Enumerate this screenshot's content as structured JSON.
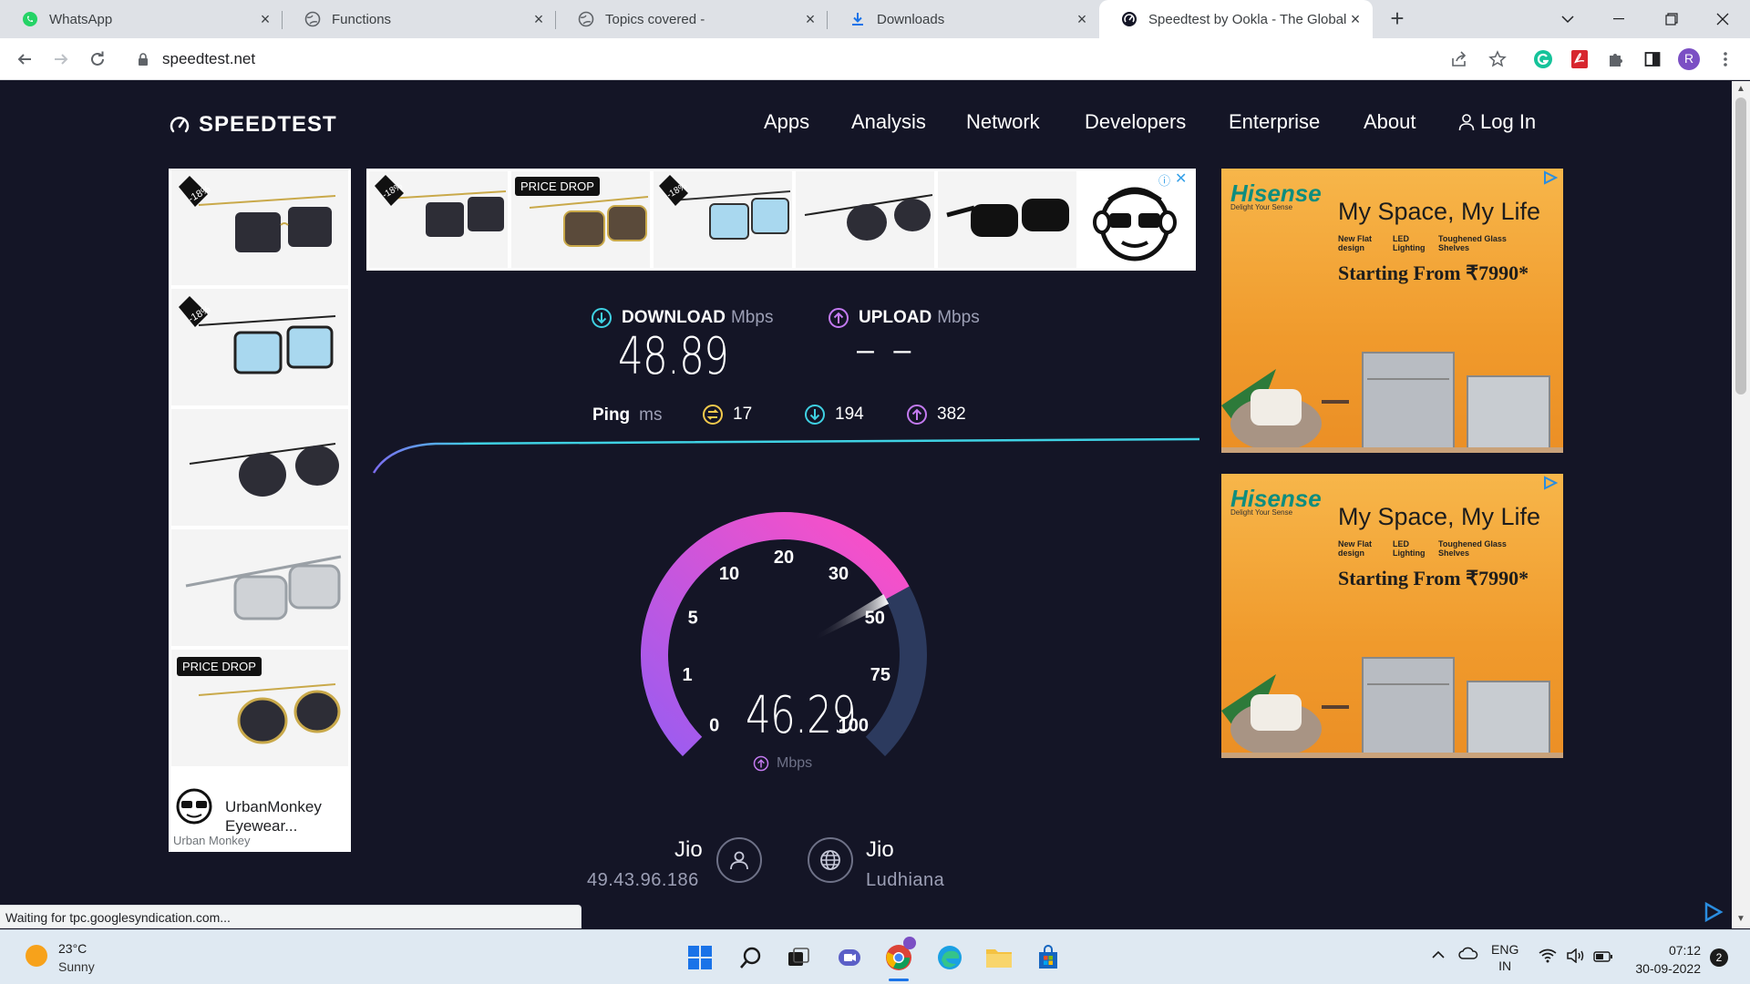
{
  "browser": {
    "tabs": [
      {
        "title": "WhatsApp",
        "icon": "whatsapp-icon",
        "active": false
      },
      {
        "title": "Functions",
        "icon": "globe-icon",
        "active": false
      },
      {
        "title": "Topics covered -",
        "icon": "globe-icon",
        "active": false
      },
      {
        "title": "Downloads",
        "icon": "download-icon",
        "active": false
      },
      {
        "title": "Speedtest by Ookla - The Global",
        "icon": "speedtest-icon",
        "active": true
      }
    ],
    "new_tab": "+",
    "url": "speedtest.net",
    "profile_initial": "R"
  },
  "site": {
    "logo": "SPEEDTEST",
    "nav": [
      "Apps",
      "Analysis",
      "Network",
      "Developers",
      "Enterprise",
      "About"
    ],
    "login": "Log In"
  },
  "ads": {
    "left_badges": {
      "pct": "-18%",
      "drop": "PRICE DROP"
    },
    "left_brand_line1": "UrbanMonkey",
    "left_brand_line2": "Eyewear...",
    "left_advertiser": "Urban Monkey",
    "top_badges": {
      "pct": "-18%",
      "drop": "PRICE DROP"
    },
    "right": {
      "brand": "Hisense",
      "brand_tag": "Delight Your Sense",
      "headline": "My Space, My Life",
      "features": [
        "New Flat design",
        "LED Lighting",
        "Toughened Glass Shelves"
      ],
      "price": "Starting From ₹7990*"
    }
  },
  "speed": {
    "download_label": "DOWNLOAD",
    "download_unit": "Mbps",
    "download_value": "48.89",
    "upload_label": "UPLOAD",
    "upload_unit": "Mbps",
    "upload_value": "– –",
    "ping_label": "Ping",
    "ping_unit": "ms",
    "ping_idle": "17",
    "ping_download": "194",
    "ping_upload": "382"
  },
  "gauge": {
    "ticks": [
      "0",
      "1",
      "5",
      "10",
      "20",
      "30",
      "50",
      "75",
      "100"
    ],
    "current_value": "46.29",
    "current_unit": "Mbps",
    "needle_value": 46.29
  },
  "server": {
    "isp": "Jio",
    "ip": "49.43.96.186",
    "host": "Jio",
    "location": "Ludhiana"
  },
  "status_text": "Waiting for tpc.googlesyndication.com...",
  "taskbar": {
    "temp": "23°C",
    "weather": "Sunny",
    "lang1": "ENG",
    "lang2": "IN",
    "time": "07:12",
    "date": "30-09-2022",
    "notif_count": "2"
  },
  "colors": {
    "page_bg": "#141526",
    "download_accent": "#3fd1e3",
    "upload_accent": "#c37af0",
    "gauge_gradient_start": "#9b5cf0",
    "gauge_gradient_end": "#ff4fc5",
    "gauge_track": "#2c3a5e"
  }
}
